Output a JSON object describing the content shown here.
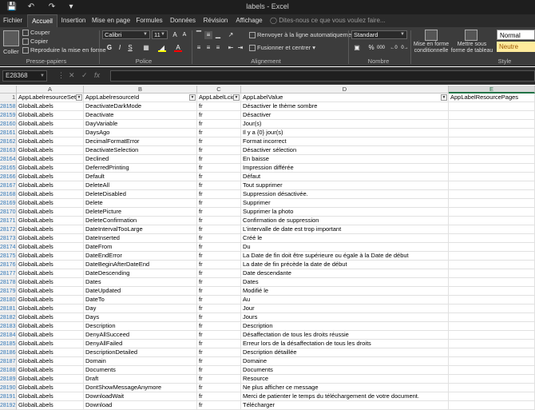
{
  "window": {
    "title": "labels - Excel"
  },
  "quick_access": {
    "save": "save-icon",
    "undo": "undo-icon",
    "redo": "redo-icon",
    "customize": "customize-icon"
  },
  "tabs": [
    "Fichier",
    "Accueil",
    "Insertion",
    "Mise en page",
    "Formules",
    "Données",
    "Révision",
    "Affichage"
  ],
  "tell_me": "Dites-nous ce que vous voulez faire...",
  "ribbon": {
    "clipboard": {
      "paste": "Coller",
      "cut": "Couper",
      "copy": "Copier",
      "format_painter": "Reproduire la mise en forme",
      "label": "Presse-papiers"
    },
    "font": {
      "name": "Calibri",
      "size": "11",
      "label": "Police",
      "bold": "G",
      "italic": "I",
      "underline": "S"
    },
    "alignment": {
      "wrap": "Renvoyer à la ligne automatiquement",
      "merge": "Fusionner et centrer",
      "label": "Alignement"
    },
    "number": {
      "format": "Standard",
      "label": "Nombre",
      "percent": "%",
      "thousands": "000"
    },
    "styles": {
      "conditional": "Mise en forme conditionnelle",
      "table": "Mettre sous forme de tableau",
      "normal": "Normal",
      "neutral": "Neutre",
      "label": "Style"
    }
  },
  "formula_bar": {
    "name_box": "E28368",
    "fx": "fx",
    "value": ""
  },
  "sheet": {
    "columns": [
      "A",
      "B",
      "C",
      "D",
      "E"
    ],
    "header_row_number": "1",
    "headers": [
      "AppLabelresourceSet",
      "AppLabelresourceId",
      "AppLabelLcid",
      "AppLabelValue",
      "AppLabelResourcePages"
    ],
    "selected_cell": "E28368",
    "rows": [
      {
        "n": "28158",
        "a": "GlobalLabels",
        "b": "DeactivateDarkMode",
        "c": "fr",
        "d": "Désactiver le thème sombre"
      },
      {
        "n": "28159",
        "a": "GlobalLabels",
        "b": "Deactivate",
        "c": "fr",
        "d": "Désactiver"
      },
      {
        "n": "28160",
        "a": "GlobalLabels",
        "b": "DayVariable",
        "c": "fr",
        "d": "Jour(s)"
      },
      {
        "n": "28161",
        "a": "GlobalLabels",
        "b": "DaysAgo",
        "c": "fr",
        "d": "Il y a {0} jour(s)"
      },
      {
        "n": "28162",
        "a": "GlobalLabels",
        "b": "DecimalFormatError",
        "c": "fr",
        "d": "Format incorrect"
      },
      {
        "n": "28163",
        "a": "GlobalLabels",
        "b": "DeactivateSelection",
        "c": "fr",
        "d": "Désactiver sélection"
      },
      {
        "n": "28164",
        "a": "GlobalLabels",
        "b": "Declined",
        "c": "fr",
        "d": "En baisse"
      },
      {
        "n": "28165",
        "a": "GlobalLabels",
        "b": "DeferredPrinting",
        "c": "fr",
        "d": "Impression différée"
      },
      {
        "n": "28166",
        "a": "GlobalLabels",
        "b": "Default",
        "c": "fr",
        "d": "Défaut"
      },
      {
        "n": "28167",
        "a": "GlobalLabels",
        "b": "DeleteAll",
        "c": "fr",
        "d": "Tout supprimer"
      },
      {
        "n": "28168",
        "a": "GlobalLabels",
        "b": "DeleteDisabled",
        "c": "fr",
        "d": "Suppression désactivée."
      },
      {
        "n": "28169",
        "a": "GlobalLabels",
        "b": "Delete",
        "c": "fr",
        "d": "Supprimer"
      },
      {
        "n": "28170",
        "a": "GlobalLabels",
        "b": "DeletePicture",
        "c": "fr",
        "d": "Supprimer la photo"
      },
      {
        "n": "28171",
        "a": "GlobalLabels",
        "b": "DeleteConfirmation",
        "c": "fr",
        "d": "Confirmation de suppression"
      },
      {
        "n": "28172",
        "a": "GlobalLabels",
        "b": "DateIntervalTooLarge",
        "c": "fr",
        "d": "L'intervalle de date est trop important"
      },
      {
        "n": "28173",
        "a": "GlobalLabels",
        "b": "DateInserted",
        "c": "fr",
        "d": "Créé le"
      },
      {
        "n": "28174",
        "a": "GlobalLabels",
        "b": "DateFrom",
        "c": "fr",
        "d": "Du"
      },
      {
        "n": "28175",
        "a": "GlobalLabels",
        "b": "DateEndError",
        "c": "fr",
        "d": "La Date de fin doit être supérieure ou égale à la Date de début"
      },
      {
        "n": "28176",
        "a": "GlobalLabels",
        "b": "DateBeginAfterDateEnd",
        "c": "fr",
        "d": "La date de fin précède la date de début"
      },
      {
        "n": "28177",
        "a": "GlobalLabels",
        "b": "DateDescending",
        "c": "fr",
        "d": "Date descendante"
      },
      {
        "n": "28178",
        "a": "GlobalLabels",
        "b": "Dates",
        "c": "fr",
        "d": "Dates"
      },
      {
        "n": "28179",
        "a": "GlobalLabels",
        "b": "DateUpdated",
        "c": "fr",
        "d": "Modifié le"
      },
      {
        "n": "28180",
        "a": "GlobalLabels",
        "b": "DateTo",
        "c": "fr",
        "d": "Au"
      },
      {
        "n": "28181",
        "a": "GlobalLabels",
        "b": "Day",
        "c": "fr",
        "d": "Jour"
      },
      {
        "n": "28182",
        "a": "GlobalLabels",
        "b": "Days",
        "c": "fr",
        "d": "Jours"
      },
      {
        "n": "28183",
        "a": "GlobalLabels",
        "b": "Description",
        "c": "fr",
        "d": "Description"
      },
      {
        "n": "28184",
        "a": "GlobalLabels",
        "b": "DenyAllSucceed",
        "c": "fr",
        "d": "Désaffectation de tous les droits réussie"
      },
      {
        "n": "28185",
        "a": "GlobalLabels",
        "b": "DenyAllFailed",
        "c": "fr",
        "d": "Erreur lors de la désaffectation de tous les droits"
      },
      {
        "n": "28186",
        "a": "GlobalLabels",
        "b": "DescriptionDetailed",
        "c": "fr",
        "d": "Description détaillée"
      },
      {
        "n": "28187",
        "a": "GlobalLabels",
        "b": "Domain",
        "c": "fr",
        "d": "Domaine"
      },
      {
        "n": "28188",
        "a": "GlobalLabels",
        "b": "Documents",
        "c": "fr",
        "d": "Documents"
      },
      {
        "n": "28189",
        "a": "GlobalLabels",
        "b": "Draft",
        "c": "fr",
        "d": "Resource"
      },
      {
        "n": "28190",
        "a": "GlobalLabels",
        "b": "DontShowMessageAnymore",
        "c": "fr",
        "d": "Ne plus afficher ce message"
      },
      {
        "n": "28191",
        "a": "GlobalLabels",
        "b": "DownloadWait",
        "c": "fr",
        "d": "Merci de patienter le temps du téléchargement de votre document."
      },
      {
        "n": "28192",
        "a": "GlobalLabels",
        "b": "Download",
        "c": "fr",
        "d": "Télécharger"
      }
    ]
  },
  "colors": {
    "excel_green": "#217346",
    "rownum_blue": "#2e75b6",
    "neutral_fill": "#ffeb9c",
    "neutral_text": "#9c5700"
  }
}
